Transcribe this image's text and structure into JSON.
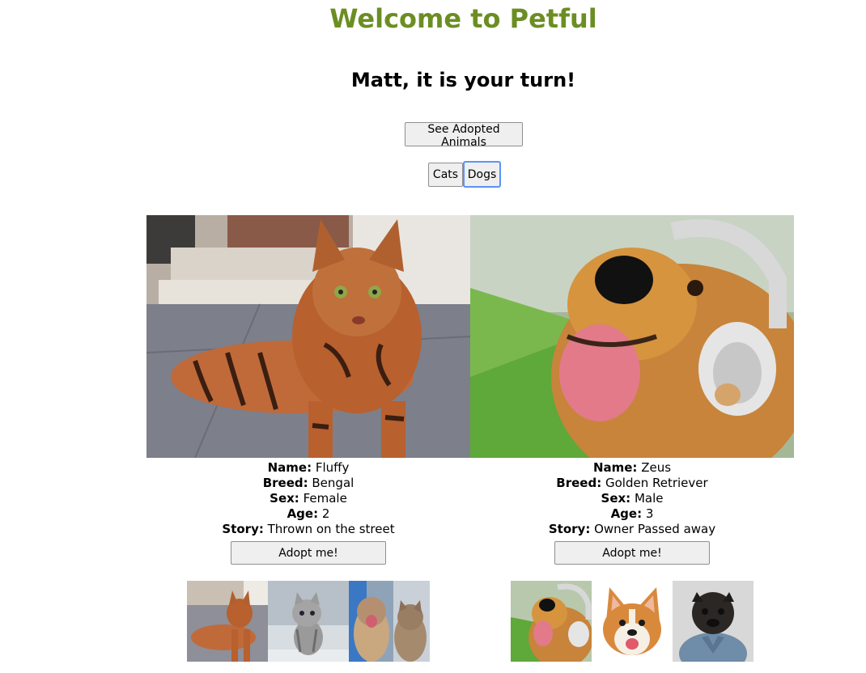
{
  "header": {
    "title": "Welcome to Petful",
    "turn_message": "Matt, it is your turn!"
  },
  "controls": {
    "see_adopted_label": "See Adopted Animals",
    "tabs": [
      {
        "label": "Cats",
        "selected": false
      },
      {
        "label": "Dogs",
        "selected": true
      }
    ]
  },
  "pets": {
    "cat": {
      "name_label": "Name:",
      "name": "Fluffy",
      "breed_label": "Breed:",
      "breed": "Bengal",
      "sex_label": "Sex:",
      "sex": "Female",
      "age_label": "Age:",
      "age": "2",
      "story_label": "Story:",
      "story": "Thrown on the street",
      "adopt_label": "Adopt me!"
    },
    "dog": {
      "name_label": "Name:",
      "name": "Zeus",
      "breed_label": "Breed:",
      "breed": "Golden Retriever",
      "sex_label": "Sex:",
      "sex": "Male",
      "age_label": "Age:",
      "age": "3",
      "story_label": "Story:",
      "story": "Owner Passed away",
      "adopt_label": "Adopt me!"
    }
  },
  "queues": {
    "cats": [
      "bengal-cat",
      "grey-tabby-kitten",
      "two-tabby-cats"
    ],
    "dogs": [
      "golden-retriever-headphones",
      "corgi",
      "pug-denim-jacket"
    ]
  },
  "colors": {
    "title": "#6b8e23",
    "focus_ring": "#5b93f7"
  }
}
